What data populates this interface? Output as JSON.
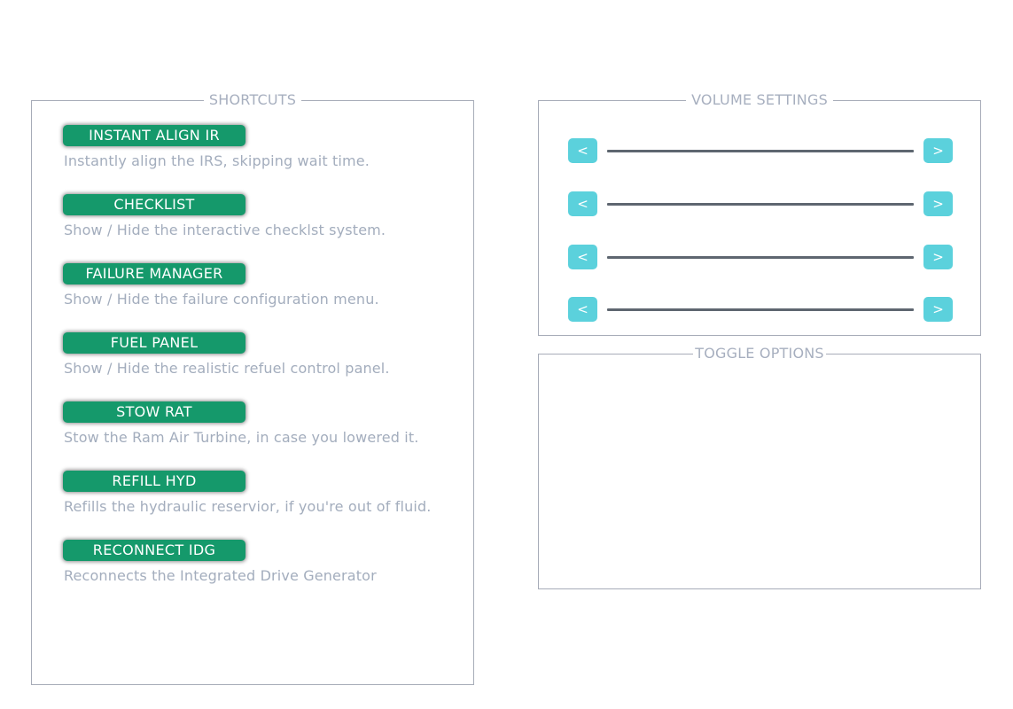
{
  "shortcuts": {
    "title": "SHORTCUTS",
    "items": [
      {
        "label": "INSTANT ALIGN IR",
        "description": "Instantly align the IRS, skipping wait time."
      },
      {
        "label": "CHECKLIST",
        "description": "Show / Hide the interactive checklst system."
      },
      {
        "label": "FAILURE MANAGER",
        "description": "Show / Hide the failure configuration menu."
      },
      {
        "label": "FUEL PANEL",
        "description": "Show / Hide the realistic refuel control panel."
      },
      {
        "label": "STOW RAT",
        "description": "Stow the Ram Air Turbine, in case you lowered it."
      },
      {
        "label": "REFILL HYD",
        "description": "Refills the hydraulic reservior, if you're out of fluid."
      },
      {
        "label": "RECONNECT IDG",
        "description": "Reconnects the Integrated Drive Generator"
      }
    ]
  },
  "volume": {
    "title": "VOLUME SETTINGS",
    "rows": [
      {
        "decrease_label": "<",
        "increase_label": ">"
      },
      {
        "decrease_label": "<",
        "increase_label": ">"
      },
      {
        "decrease_label": "<",
        "increase_label": ">"
      },
      {
        "decrease_label": "<",
        "increase_label": ">"
      }
    ]
  },
  "toggle": {
    "title": "TOGGLE OPTIONS"
  },
  "colors": {
    "shortcut_button": "#15996b",
    "volume_button": "#5bd1dc",
    "slider_track": "#5e6670",
    "panel_border": "#a7acb8",
    "text_muted": "#a3adbd"
  }
}
